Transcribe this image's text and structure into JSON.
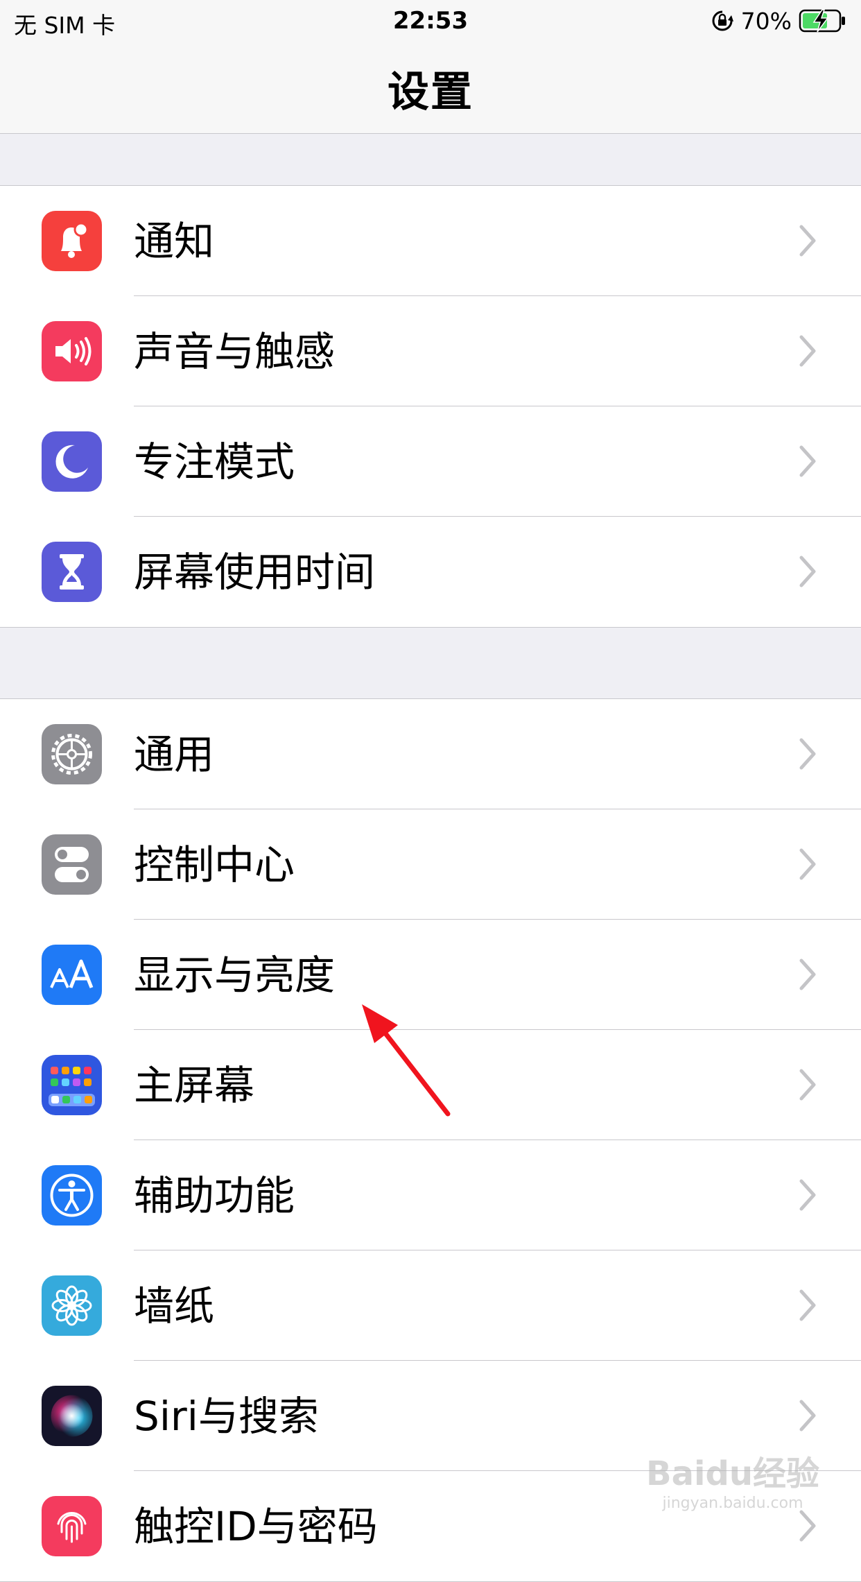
{
  "status_bar": {
    "carrier": "无 SIM 卡",
    "time": "22:53",
    "battery_percent": "70%",
    "battery_level": 0.7,
    "icons": [
      "orientation-lock-icon",
      "battery-charging-icon"
    ]
  },
  "nav": {
    "title": "设置"
  },
  "groups": [
    {
      "items": [
        {
          "label": "通知",
          "icon": "notifications-icon",
          "color": "#f5403d"
        },
        {
          "label": "声音与触感",
          "icon": "sounds-icon",
          "color": "#f43b5e"
        },
        {
          "label": "专注模式",
          "icon": "focus-moon-icon",
          "color": "#5b5ad8"
        },
        {
          "label": "屏幕使用时间",
          "icon": "screen-time-icon",
          "color": "#5b5ad8"
        }
      ]
    },
    {
      "items": [
        {
          "label": "通用",
          "icon": "gear-icon",
          "color": "#8e8e93"
        },
        {
          "label": "控制中心",
          "icon": "control-center-icon",
          "color": "#8e8e93"
        },
        {
          "label": "显示与亮度",
          "icon": "display-brightness-icon",
          "color": "#1f7af6"
        },
        {
          "label": "主屏幕",
          "icon": "home-screen-icon",
          "color": "#2f57e0"
        },
        {
          "label": "辅助功能",
          "icon": "accessibility-icon",
          "color": "#1f7af6"
        },
        {
          "label": "墙纸",
          "icon": "wallpaper-icon",
          "color": "#35aadc"
        },
        {
          "label": "Siri与搜索",
          "icon": "siri-icon",
          "color": "#1c1c2e"
        },
        {
          "label": "触控ID与密码",
          "icon": "touch-id-icon",
          "color": "#f43b5e"
        }
      ]
    }
  ],
  "annotation": {
    "icon": "red-arrow-icon",
    "color": "#f0141e"
  },
  "watermark": {
    "logo": "Baidu经验",
    "sub": "jingyan.baidu.com"
  }
}
